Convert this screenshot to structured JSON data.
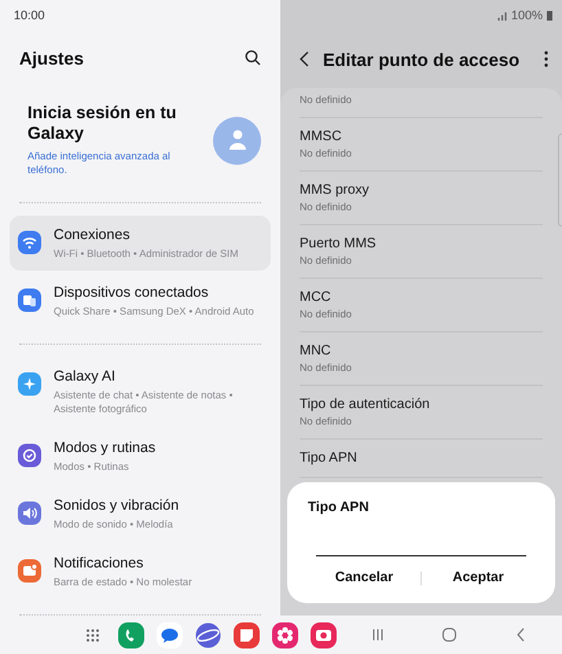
{
  "status_bar": {
    "time": "10:00",
    "battery": "100%"
  },
  "settings": {
    "title": "Ajustes",
    "account": {
      "title": "Inicia sesión en tu Galaxy",
      "subtitle": "Añade inteligencia avanzada al teléfono."
    },
    "groups": [
      [
        {
          "kind": "wifi",
          "color": "#3e7cf0",
          "title": "Conexiones",
          "subtitle": "Wi-Fi • Bluetooth • Administrador de SIM",
          "selected": true
        },
        {
          "kind": "devices",
          "color": "#3e7cf0",
          "title": "Dispositivos conectados",
          "subtitle": "Quick Share • Samsung DeX • Android Auto",
          "selected": false
        }
      ],
      [
        {
          "kind": "ai",
          "color": "#3aa2f0",
          "title": "Galaxy AI",
          "subtitle": "Asistente de chat • Asistente de notas • Asistente fotográfico",
          "selected": false
        },
        {
          "kind": "modes",
          "color": "#6a5bd8",
          "title": "Modos y rutinas",
          "subtitle": "Modos • Rutinas",
          "selected": false
        },
        {
          "kind": "sound",
          "color": "#6b76dc",
          "title": "Sonidos y vibración",
          "subtitle": "Modo de sonido • Melodía",
          "selected": false
        },
        {
          "kind": "bell",
          "color": "#ec6a35",
          "title": "Notificaciones",
          "subtitle": "Barra de estado • No molestar",
          "selected": false
        }
      ]
    ]
  },
  "apn_editor": {
    "title": "Editar punto de acceso",
    "rows": [
      {
        "value": "No definido"
      },
      {
        "label": "MMSC",
        "value": "No definido"
      },
      {
        "label": "MMS proxy",
        "value": "No definido"
      },
      {
        "label": "Puerto MMS",
        "value": "No definido"
      },
      {
        "label": "MCC",
        "value": "No definido"
      },
      {
        "label": "MNC",
        "value": "No definido"
      },
      {
        "label": "Tipo de autenticación",
        "value": "No definido"
      },
      {
        "label": "Tipo APN"
      }
    ]
  },
  "dialog": {
    "title": "Tipo APN",
    "buttons": [
      "Cancelar",
      "Aceptar"
    ]
  },
  "dock": [
    {
      "kind": "grid"
    },
    {
      "kind": "phone",
      "color": "#11a060"
    },
    {
      "kind": "messages",
      "color": "#1a6ee8"
    },
    {
      "kind": "browser",
      "color": "#5b5fd6"
    },
    {
      "kind": "notes",
      "color": "#e83a3a"
    },
    {
      "kind": "flower",
      "color": "#e4286f"
    },
    {
      "kind": "camera",
      "color": "#e8285a"
    }
  ],
  "nav": [
    {
      "kind": "recents"
    },
    {
      "kind": "home"
    },
    {
      "kind": "back"
    }
  ]
}
